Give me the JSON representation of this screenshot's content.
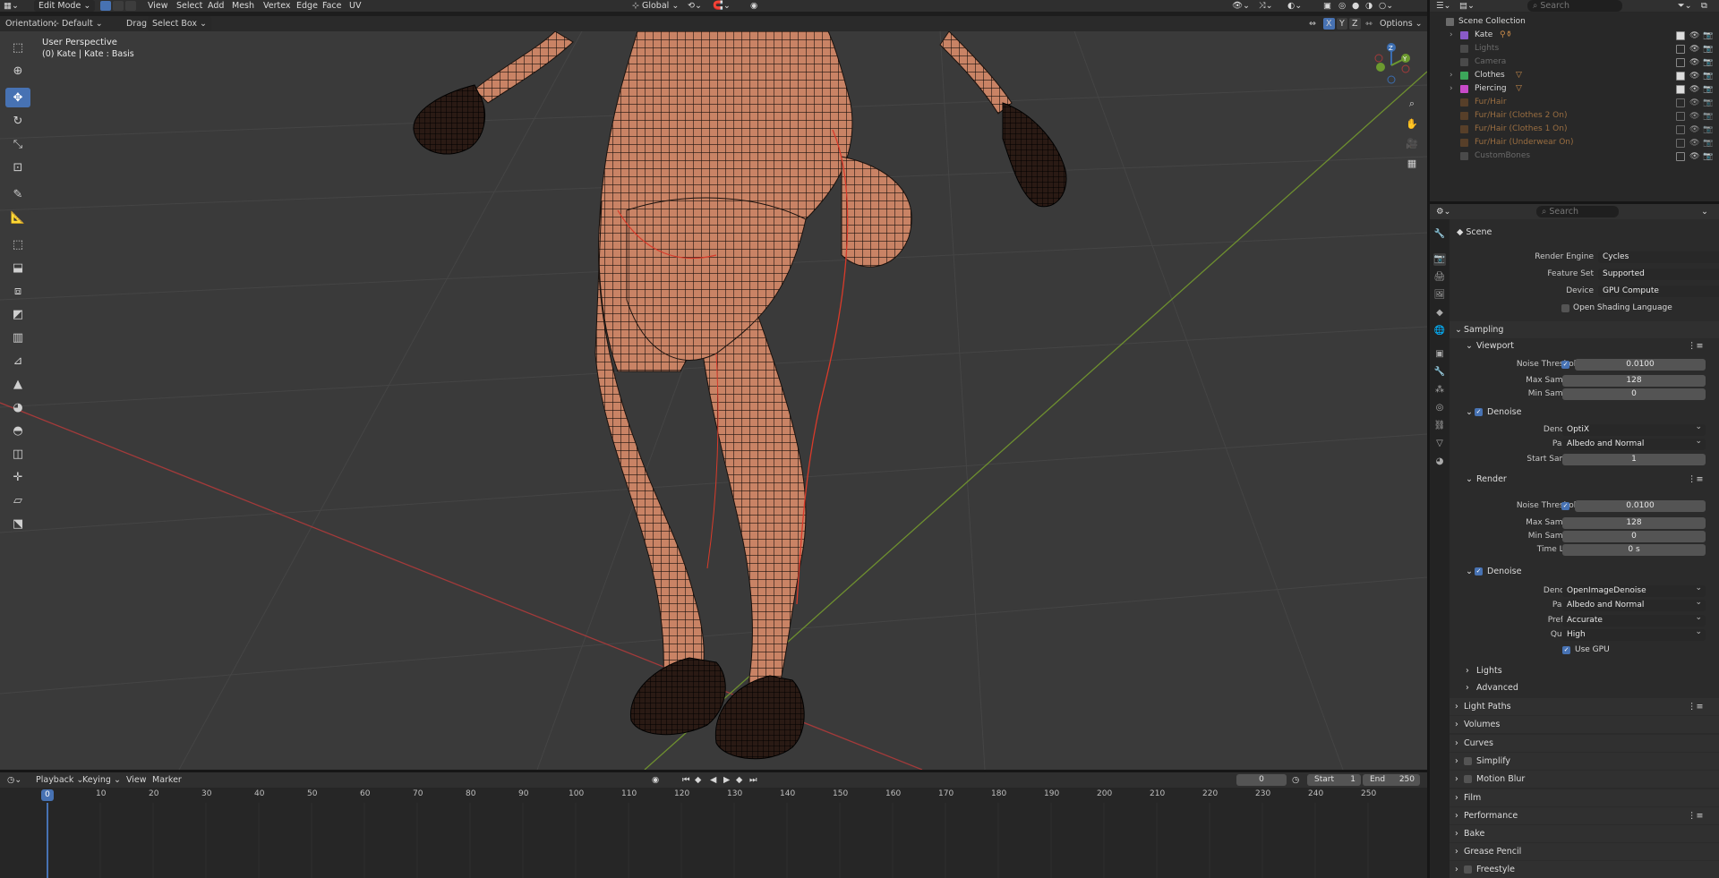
{
  "header": {
    "mode": "Edit Mode",
    "menus": [
      "View",
      "Select",
      "Add",
      "Mesh",
      "Vertex",
      "Edge",
      "Face",
      "UV"
    ],
    "transform_orientation": "Global",
    "search_placeholder": "Search"
  },
  "toolbar": {
    "orientation_label": "Orientation:",
    "orientation_value": "Default",
    "drag_label": "Drag:",
    "drag_value": "Select Box",
    "x": "X",
    "y": "Y",
    "z": "Z",
    "options": "Options"
  },
  "viewport": {
    "perspective": "User Perspective",
    "object_info": "(0) Kate | Kate : Basis",
    "gizmo": {
      "z": "Z",
      "y": "Y"
    }
  },
  "outliner": {
    "search_placeholder": "Search",
    "root": "Scene Collection",
    "items": [
      {
        "name": "Kate",
        "dim": false
      },
      {
        "name": "Lights",
        "dim": true
      },
      {
        "name": "Camera",
        "dim": true
      },
      {
        "name": "Clothes",
        "dim": false
      },
      {
        "name": "Piercing",
        "dim": false
      },
      {
        "name": "Fur/Hair",
        "dim": true
      },
      {
        "name": "Fur/Hair (Clothes 2 On)",
        "dim": true
      },
      {
        "name": "Fur/Hair (Clothes 1 On)",
        "dim": true
      },
      {
        "name": "Fur/Hair (Underwear On)",
        "dim": true
      },
      {
        "name": "CustomBones",
        "dim": true
      }
    ]
  },
  "properties": {
    "search_placeholder": "Search",
    "context": "Scene",
    "render_engine_label": "Render Engine",
    "render_engine": "Cycles",
    "feature_set_label": "Feature Set",
    "feature_set": "Supported",
    "device_label": "Device",
    "device": "GPU Compute",
    "osl": "Open Shading Language",
    "sampling": "Sampling",
    "viewport": "Viewport",
    "render": "Render",
    "noise_threshold_label": "Noise Threshold",
    "max_samples_label": "Max Samples",
    "min_samples_label": "Min Samples",
    "time_limit_label": "Time Limit",
    "denoise": "Denoise",
    "denoiser_label": "Denoiser",
    "passes_label": "Passes",
    "start_sample_label": "Start Sample",
    "prefilter_label": "Prefilter",
    "quality_label": "Quality",
    "use_gpu": "Use GPU",
    "vp_noise_threshold": "0.0100",
    "vp_max_samples": "128",
    "vp_min_samples": "0",
    "vp_denoiser": "OptiX",
    "vp_passes": "Albedo and Normal",
    "vp_start_sample": "1",
    "r_noise_threshold": "0.0100",
    "r_max_samples": "128",
    "r_min_samples": "0",
    "r_time_limit": "0 s",
    "r_denoiser": "OpenImageDenoise",
    "r_passes": "Albedo and Normal",
    "r_prefilter": "Accurate",
    "r_quality": "High",
    "lights": "Lights",
    "advanced": "Advanced",
    "sections": [
      "Light Paths",
      "Volumes",
      "Curves",
      "Simplify",
      "Motion Blur",
      "Film",
      "Performance",
      "Bake",
      "Grease Pencil",
      "Freestyle"
    ]
  },
  "timeline": {
    "menus": [
      "Playback",
      "Keying",
      "View",
      "Marker"
    ],
    "current_frame": "0",
    "start_label": "Start",
    "start": "1",
    "end_label": "End",
    "end": "250",
    "ticks": [
      "0",
      "10",
      "20",
      "30",
      "40",
      "50",
      "60",
      "70",
      "80",
      "90",
      "100",
      "110",
      "120",
      "130",
      "140",
      "150",
      "160",
      "170",
      "180",
      "190",
      "200",
      "210",
      "220",
      "230",
      "240",
      "250"
    ]
  },
  "colors": {
    "accent": "#4772b3",
    "mesh": "#b8724f",
    "x_axis": "#a33a3a",
    "y_axis": "#6e8f2f"
  }
}
